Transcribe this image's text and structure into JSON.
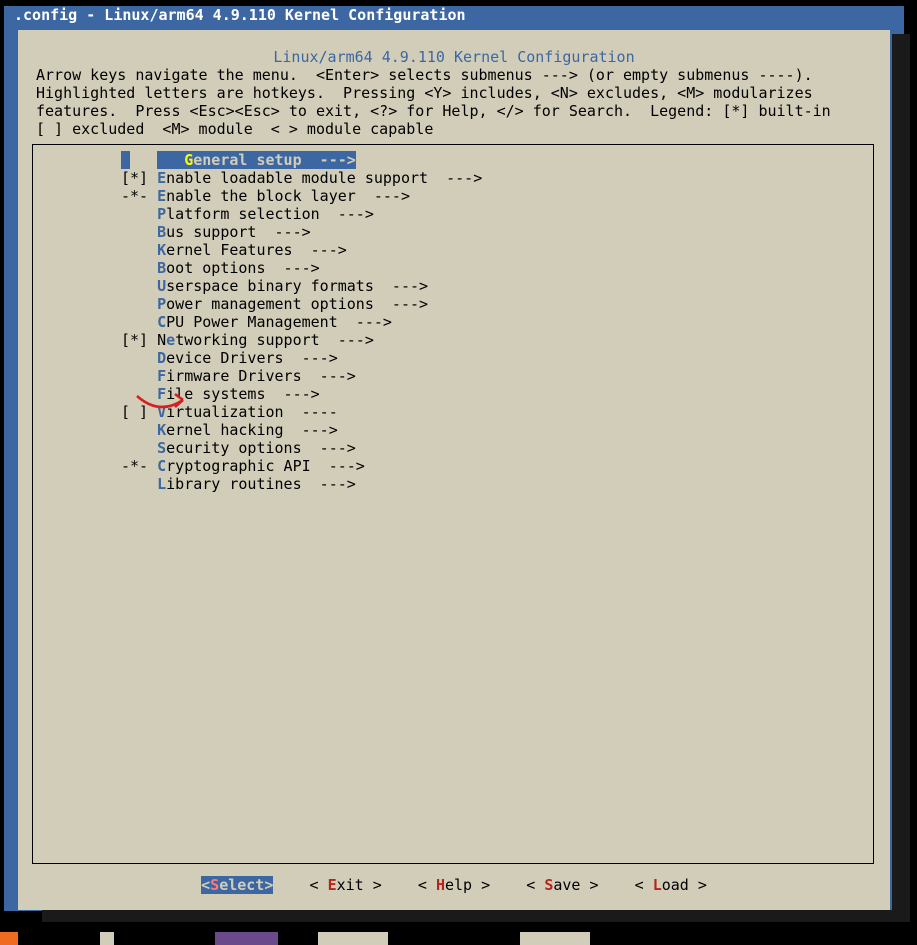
{
  "window_title": ".config - Linux/arm64 4.9.110 Kernel Configuration",
  "panel_title": "Linux/arm64 4.9.110 Kernel Configuration",
  "help_line1": "Arrow keys navigate the menu.  <Enter> selects submenus ---> (or empty submenus ----).",
  "help_line2": "Highlighted letters are hotkeys.  Pressing <Y> includes, <N> excludes, <M> modularizes",
  "help_line3": "features.  Press <Esc><Esc> to exit, <?> for Help, </> for Search.  Legend: [*] built-in",
  "help_line4": "[ ] excluded  <M> module  < > module capable",
  "items": [
    {
      "prefix": "   ",
      "hk": "G",
      "rest": "eneral setup  --->",
      "selected": true
    },
    {
      "prefix": "[*]",
      "hk": "E",
      "rest": "nable loadable module support  --->"
    },
    {
      "prefix": "-*-",
      "hk": "E",
      "rest": "nable the block layer  --->"
    },
    {
      "prefix": "   ",
      "hk": "P",
      "rest": "latform selection  --->"
    },
    {
      "prefix": "   ",
      "hk": "B",
      "rest": "us support  --->"
    },
    {
      "prefix": "   ",
      "hk": "K",
      "rest": "ernel Features  --->"
    },
    {
      "prefix": "   ",
      "hk": "B",
      "rest": "oot options  --->"
    },
    {
      "prefix": "   ",
      "hk": "U",
      "rest": "serspace binary formats  --->"
    },
    {
      "prefix": "   ",
      "hk": "P",
      "rest": "ower management options  --->"
    },
    {
      "prefix": "   ",
      "hk": "C",
      "rest": "PU Power Management  --->"
    },
    {
      "prefix": "[*]",
      "hk": "e",
      "rest": "tworking support  --->",
      "lead": "N"
    },
    {
      "prefix": "   ",
      "hk": "D",
      "rest": "evice Drivers  --->"
    },
    {
      "prefix": "   ",
      "hk": "F",
      "rest": "irmware Drivers  --->"
    },
    {
      "prefix": "   ",
      "hk": "F",
      "rest": "ile systems  --->"
    },
    {
      "prefix": "[ ]",
      "hk": "V",
      "rest": "irtualization  ----"
    },
    {
      "prefix": "   ",
      "hk": "K",
      "rest": "ernel hacking  --->"
    },
    {
      "prefix": "   ",
      "hk": "S",
      "rest": "ecurity options  --->"
    },
    {
      "prefix": "-*-",
      "hk": "C",
      "rest": "ryptographic API  --->"
    },
    {
      "prefix": "   ",
      "hk": "L",
      "rest": "ibrary routines  --->"
    }
  ],
  "buttons": {
    "select": {
      "pre": "<",
      "hk": "S",
      "post": "elect>"
    },
    "exit": {
      "pre": "< ",
      "hk": "E",
      "post": "xit >"
    },
    "help": {
      "pre": "< ",
      "hk": "H",
      "post": "elp >"
    },
    "save": {
      "pre": "< ",
      "hk": "S",
      "post": "ave >"
    },
    "load": {
      "pre": "< ",
      "hk": "L",
      "post": "oad >"
    }
  }
}
